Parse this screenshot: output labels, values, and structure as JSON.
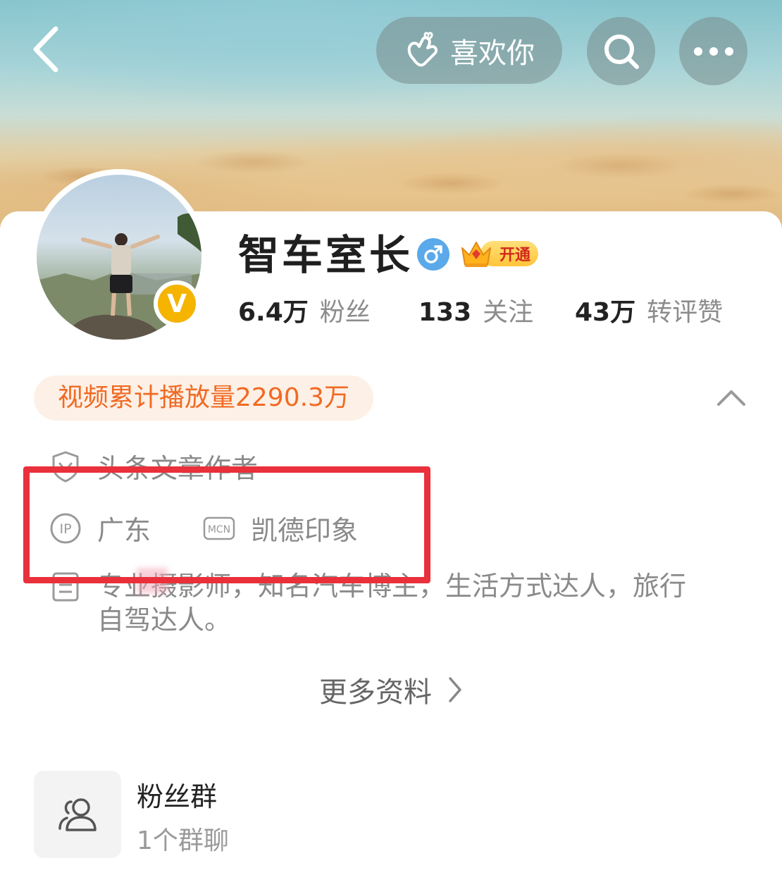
{
  "header": {
    "like_label": "喜欢你"
  },
  "profile": {
    "name": "智车室长",
    "vip_label": "开通",
    "verified_badge": "V",
    "stats": {
      "fans_count": "6.4万",
      "fans_label": "粉丝",
      "following_count": "133",
      "following_label": "关注",
      "likes_count": "43万",
      "likes_label": "转评赞"
    },
    "play_count_text": "视频累计播放量2290.3万",
    "author_tag": "头条文章作者",
    "ip_location": "广东",
    "mcn_label": "MCN",
    "mcn_name": "凯德印象",
    "bio": "专业摄影师，知名汽车博主，生活方式达人，旅行自驾达人。",
    "more_info_label": "更多资料"
  },
  "fans_group": {
    "title": "粉丝群",
    "subtitle": "1个群聊"
  },
  "colors": {
    "accent_orange": "#f16a23",
    "highlight_red": "#e9303b",
    "gender_blue": "#5aa9ea",
    "badge_gold": "#f4b400"
  },
  "icons": {
    "back": "chevron-left-icon",
    "like": "finger-heart-icon",
    "search": "search-icon",
    "more": "more-dots-icon",
    "collapse": "chevron-up-icon",
    "author": "shield-v-icon",
    "ip": "ip-icon",
    "mcn": "mcn-icon",
    "bio": "document-icon",
    "more_info": "chevron-right-icon",
    "fans_group": "group-icon"
  }
}
